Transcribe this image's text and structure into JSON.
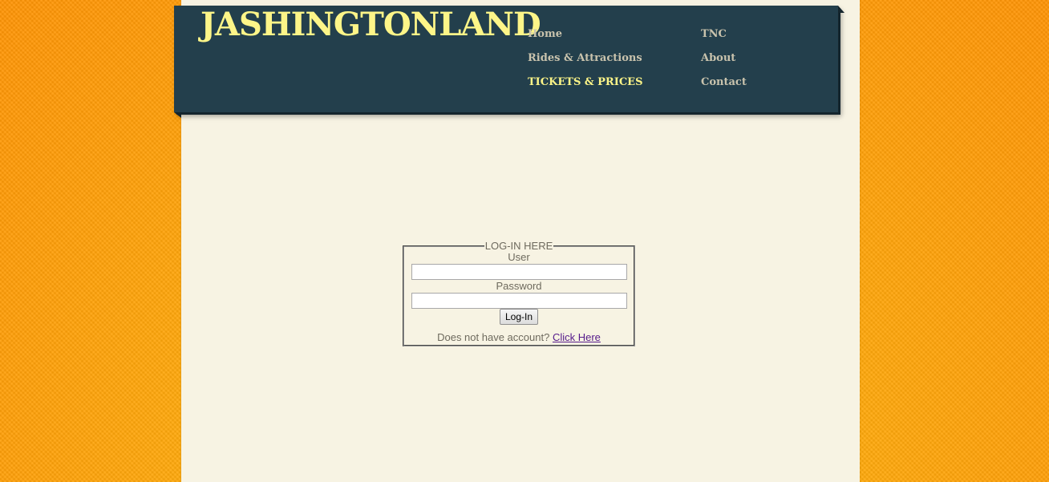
{
  "site": {
    "title": "JASHINGTONLAND"
  },
  "nav": {
    "items": [
      {
        "label": "Home",
        "active": false
      },
      {
        "label": "Rides & Attractions",
        "active": false
      },
      {
        "label": "TICKETS & PRICES",
        "active": true
      },
      {
        "label": "TNC",
        "active": false
      },
      {
        "label": "About",
        "active": false
      },
      {
        "label": "Contact",
        "active": false
      }
    ]
  },
  "login": {
    "legend": "LOG-IN HERE",
    "user_label": "User",
    "user_value": "",
    "password_label": "Password",
    "password_value": "",
    "button_label": "Log-In",
    "signup_prompt": "Does not have account?",
    "signup_link": "Click Here"
  },
  "colors": {
    "header_bg": "#233f4c",
    "title": "#fdf588",
    "nav_text": "#c9c3ad",
    "nav_active": "#fdf588",
    "page_bg": "#f7f3e3",
    "body_bg": "#ffab0c",
    "link": "#551a8b"
  }
}
